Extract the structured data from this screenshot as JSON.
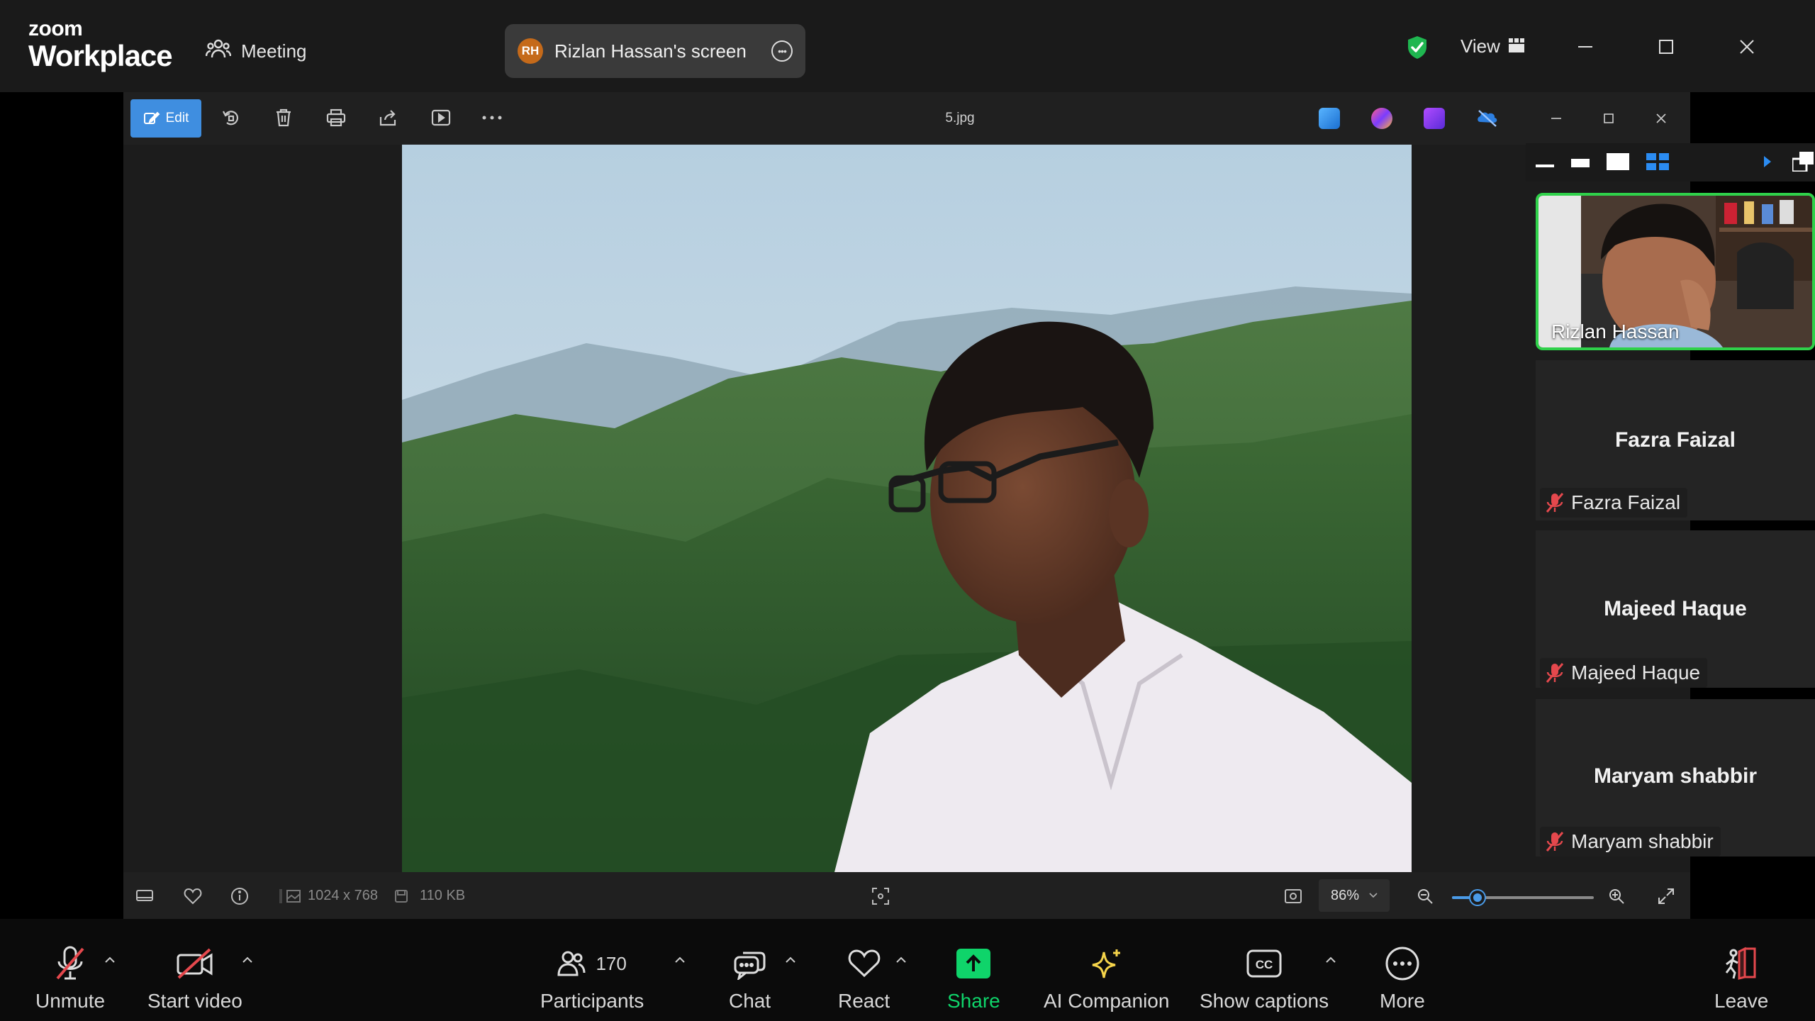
{
  "app": {
    "logo_top": "zoom",
    "logo_bottom": "Workplace",
    "meeting_label": "Meeting",
    "screen_share": {
      "avatar_initials": "RH",
      "label": "Rizlan Hassan's screen"
    },
    "view_label": "View"
  },
  "viewer": {
    "edit_label": "Edit",
    "file_name": "5.jpg",
    "dimensions": "1024 x 768",
    "file_size": "110 KB",
    "zoom_level": "86%",
    "zoom_fraction": 0.18
  },
  "participants_panel": {
    "video_tile": {
      "name": "Rizlan Hassan"
    },
    "tiles": [
      {
        "name": "Fazra Faizal",
        "tag": "Fazra Faizal",
        "muted": true
      },
      {
        "name": "Majeed Haque",
        "tag": "Majeed Haque",
        "muted": true
      },
      {
        "name": "Maryam shabbir",
        "tag": "Maryam shabbir",
        "muted": true
      }
    ]
  },
  "toolbar": {
    "unmute": "Unmute",
    "start_video": "Start video",
    "participants": "Participants",
    "participants_count": "170",
    "chat": "Chat",
    "react": "React",
    "share": "Share",
    "ai_companion": "AI Companion",
    "show_captions": "Show captions",
    "more": "More",
    "leave": "Leave"
  },
  "colors": {
    "active_speaker": "#2fd14a",
    "share": "#0fd46a",
    "ai_companion": "#f4d34a",
    "edit_button": "#3f8ee0",
    "muted": "#e5484d"
  }
}
